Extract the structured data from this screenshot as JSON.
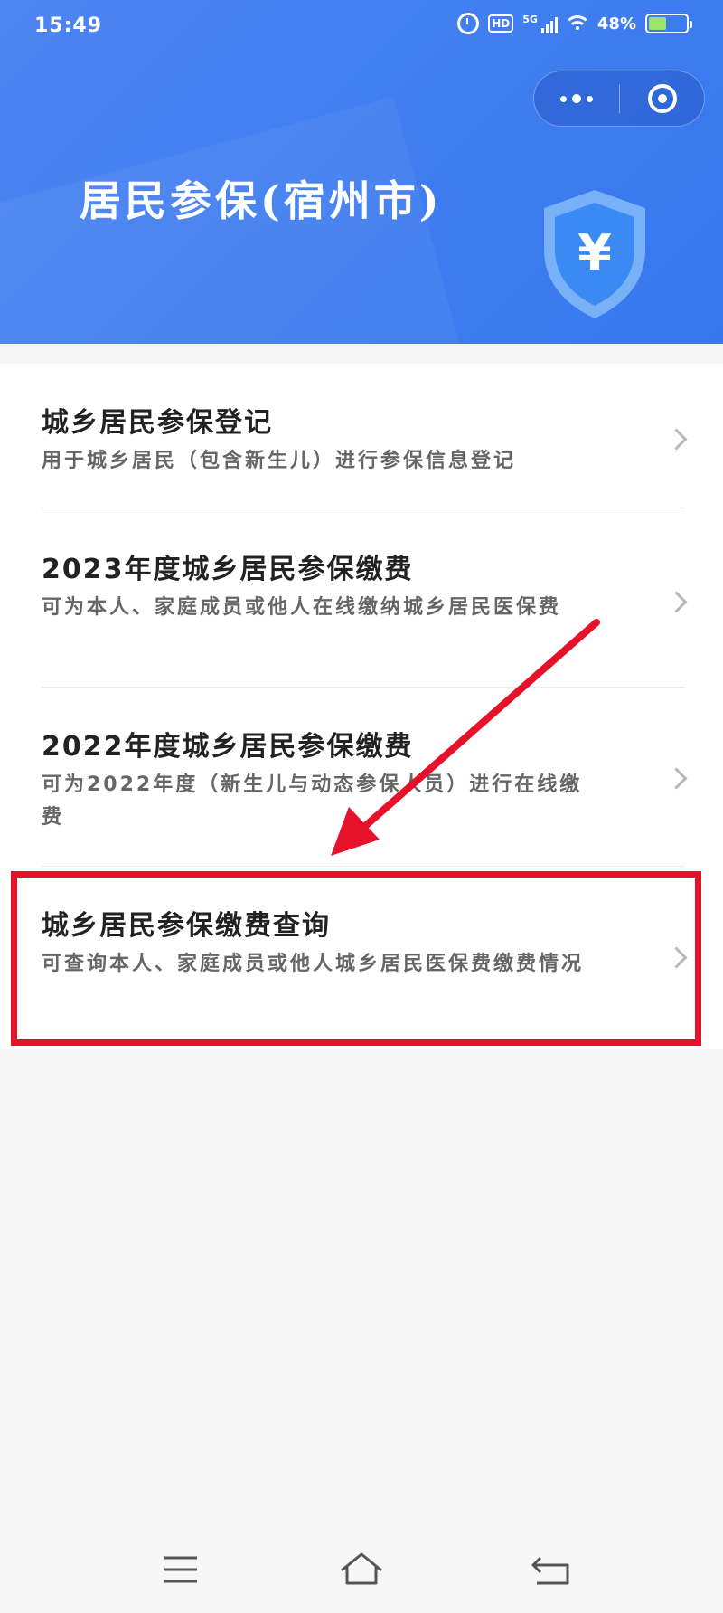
{
  "status_bar": {
    "time": "15:49",
    "network": "5G",
    "hd_label": "HD",
    "battery_percent": "48%",
    "battery_level": 0.48,
    "icons": [
      "alarm-icon",
      "hd-icon",
      "signal-icon",
      "wifi-icon",
      "battery-icon"
    ]
  },
  "miniprogram_capsule": {
    "icons": [
      "more-dots-icon",
      "close-target-icon"
    ]
  },
  "header": {
    "title": "居民参保(宿州市)",
    "shield_symbol": "¥",
    "accent": "#4082f0"
  },
  "menu": {
    "items": [
      {
        "title": "城乡居民参保登记",
        "desc": "用于城乡居民（包含新生儿）进行参保信息登记"
      },
      {
        "title": "2023年度城乡居民参保缴费",
        "desc": "可为本人、家庭成员或他人在线缴纳城乡居民医保费"
      },
      {
        "title": "2022年度城乡居民参保缴费",
        "desc": "可为2022年度（新生儿与动态参保人员）进行在线缴费"
      },
      {
        "title": "城乡居民参保缴费查询",
        "desc": "可查询本人、家庭成员或他人城乡居民医保费缴费情况"
      }
    ]
  },
  "annotation": {
    "highlight_color": "#e5122a"
  },
  "system_nav": {
    "icons": [
      "menu-icon",
      "home-icon",
      "back-icon"
    ]
  }
}
